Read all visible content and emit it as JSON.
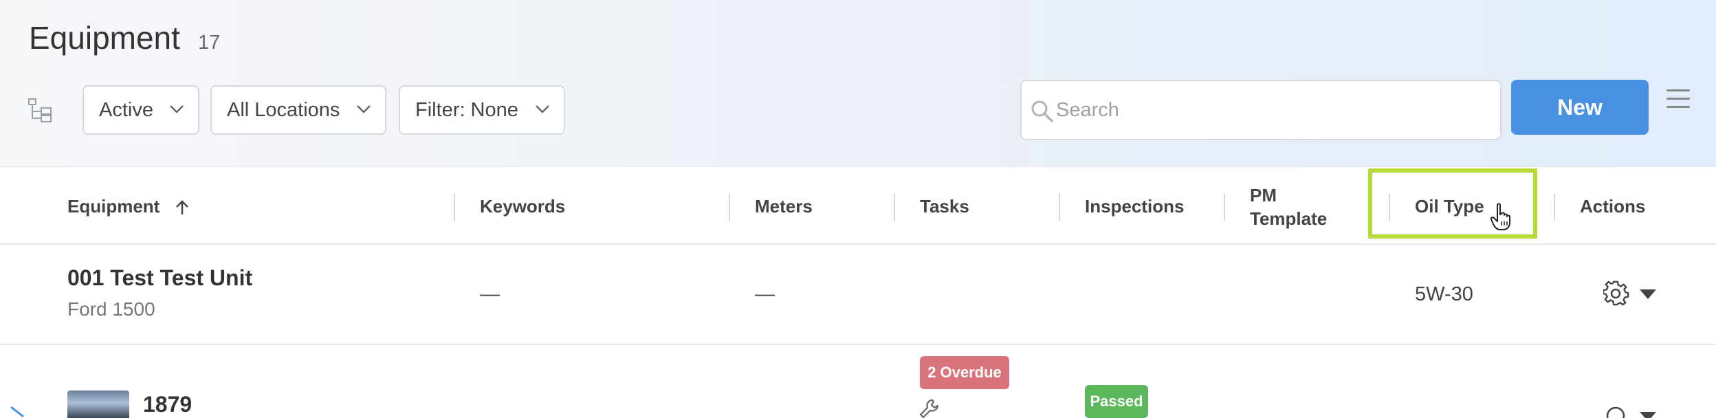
{
  "header": {
    "title": "Equipment",
    "count": "17",
    "filters": {
      "status": "Active",
      "location": "All Locations",
      "filter": "Filter: None"
    },
    "search": {
      "placeholder": "Search"
    },
    "new_label": "New"
  },
  "table": {
    "columns": {
      "equipment": "Equipment",
      "keywords": "Keywords",
      "meters": "Meters",
      "tasks": "Tasks",
      "inspections": "Inspections",
      "pm_template_line1": "PM",
      "pm_template_line2": "Template",
      "oil_type": "Oil Type",
      "actions": "Actions"
    },
    "rows": [
      {
        "name": "001 Test Test Unit",
        "subtitle": "Ford 1500",
        "keywords": "—",
        "meters": "—",
        "oil_type": "5W-30"
      },
      {
        "name": "1879",
        "tasks_badge": "2 Overdue",
        "inspection_badge": "Passed"
      }
    ]
  },
  "colors": {
    "accent": "#4a90e2",
    "highlight": "#b6da3c",
    "overdue": "#d9757a",
    "passed": "#5cb85c"
  },
  "icons": [
    "tree-view-icon",
    "chevron-down-icon",
    "search-icon",
    "menu-icon",
    "sort-up-icon",
    "pointer-cursor-icon",
    "gear-icon",
    "caret-down-icon",
    "wrench-icon",
    "expand-icon"
  ]
}
